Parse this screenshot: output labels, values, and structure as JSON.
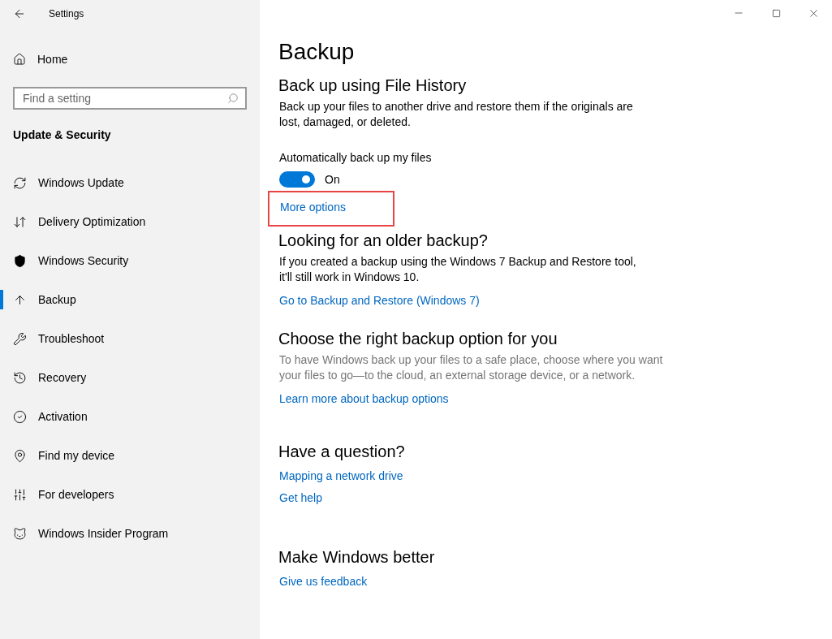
{
  "window": {
    "title": "Settings"
  },
  "sidebar": {
    "home": "Home",
    "search": {
      "placeholder": "Find a setting"
    },
    "category": "Update & Security",
    "items": [
      {
        "label": "Windows Update",
        "selected": false
      },
      {
        "label": "Delivery Optimization",
        "selected": false
      },
      {
        "label": "Windows Security",
        "selected": false
      },
      {
        "label": "Backup",
        "selected": true
      },
      {
        "label": "Troubleshoot",
        "selected": false
      },
      {
        "label": "Recovery",
        "selected": false
      },
      {
        "label": "Activation",
        "selected": false
      },
      {
        "label": "Find my device",
        "selected": false
      },
      {
        "label": "For developers",
        "selected": false
      },
      {
        "label": "Windows Insider Program",
        "selected": false
      }
    ]
  },
  "page": {
    "title": "Backup",
    "sections": [
      {
        "heading": "Back up using File History",
        "text": "Back up your files to another drive and restore them if the originals are lost, damaged, or deleted.",
        "muted": false,
        "toggle": {
          "label": "Automatically back up my files",
          "on": true,
          "state_text": "On"
        },
        "links": [
          {
            "label": "More options",
            "highlighted": true
          }
        ]
      },
      {
        "heading": "Looking for an older backup?",
        "text": "If you created a backup using the Windows 7 Backup and Restore tool, it'll still work in Windows 10.",
        "muted": false,
        "links": [
          {
            "label": "Go to Backup and Restore (Windows 7)",
            "highlighted": false
          }
        ]
      },
      {
        "heading": "Choose the right backup option for you",
        "text": "To have Windows back up your files to a safe place, choose where you want your files to go—to the cloud, an external storage device, or a network.",
        "muted": true,
        "links": [
          {
            "label": "Learn more about backup options",
            "highlighted": false
          }
        ]
      },
      {
        "heading": "Have a question?",
        "links": [
          {
            "label": "Mapping a network drive",
            "highlighted": false
          },
          {
            "label": "Get help",
            "highlighted": false
          }
        ]
      },
      {
        "heading": "Make Windows better",
        "links": [
          {
            "label": "Give us feedback",
            "highlighted": false
          }
        ]
      }
    ]
  }
}
